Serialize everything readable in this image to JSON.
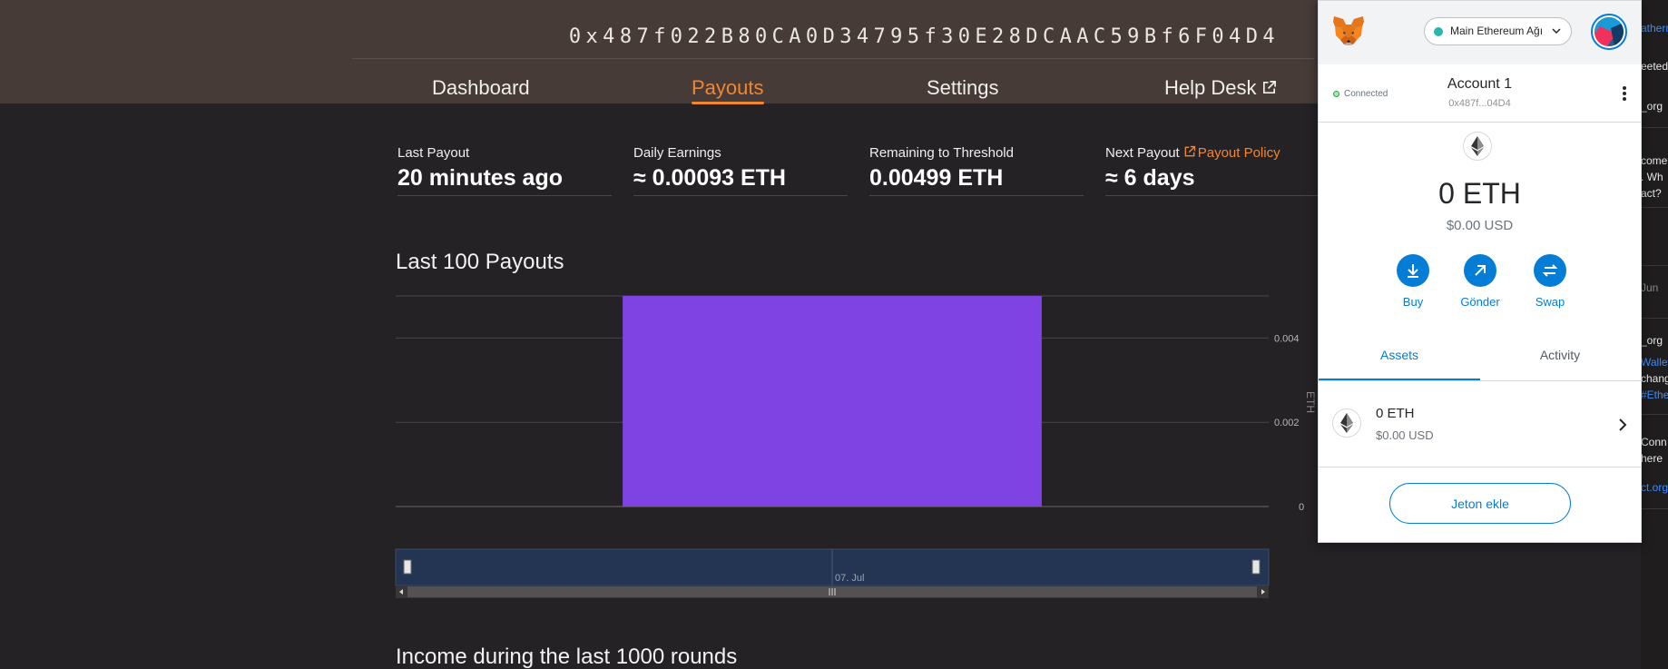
{
  "header": {
    "address": "0x487f022B80CA0D34795f30E28DCAAC59Bf6F04D4",
    "nav": {
      "dashboard": "Dashboard",
      "payouts": "Payouts",
      "settings": "Settings",
      "help_desk": "Help Desk"
    },
    "active_tab": "payouts",
    "accent_color": "#f1862f"
  },
  "stats": [
    {
      "label": "Last Payout",
      "value": "20 minutes ago"
    },
    {
      "label": "Daily Earnings",
      "value": "≈ 0.00093  ETH"
    },
    {
      "label": "Remaining to Threshold",
      "value": "0.00499  ETH"
    },
    {
      "label": "Next Payout",
      "value": "≈ 6 days",
      "link": "Payout Policy"
    }
  ],
  "sections": {
    "payouts_title": "Last 100 Payouts",
    "income_title": "Income during the last 1000 rounds"
  },
  "chart_data": {
    "type": "bar",
    "categories": [
      "07. Jul"
    ],
    "values": [
      0.005
    ],
    "title": "Last 100 Payouts",
    "xlabel": "",
    "ylabel": "ETH",
    "ylim": [
      0,
      0.005
    ],
    "yticks": [
      0,
      0.002,
      0.004
    ],
    "ytick_labels": [
      "0",
      "0.002",
      "0.004"
    ],
    "y_axis_side": "right",
    "grid": true,
    "bar_color": "#8043e3",
    "navigator_label": "07. Jul"
  },
  "metamask": {
    "network": "Main Ethereum Ağı",
    "network_color": "#29b6af",
    "connected_label": "Connected",
    "account_name": "Account 1",
    "account_address": "0x487f...04D4",
    "balance": "0 ETH",
    "balance_usd": "$0.00 USD",
    "actions": {
      "buy": "Buy",
      "send": "Gönder",
      "swap": "Swap"
    },
    "tabs": {
      "assets": "Assets",
      "activity": "Activity"
    },
    "active_tab": "assets",
    "asset": {
      "balance": "0 ETH",
      "usd": "$0.00 USD"
    },
    "add_token": "Jeton ekle",
    "brand_color": "#037dd6"
  },
  "side_strip": {
    "items": [
      {
        "text": "atherm",
        "style": "link"
      },
      {
        "text": "eeted",
        "style": "text"
      },
      {
        "text": "_org",
        "style": "text"
      },
      {
        "text": "come",
        "style": "text"
      },
      {
        "text": ". Wh",
        "style": "text"
      },
      {
        "text": "act?",
        "style": "text"
      },
      {
        "text": "Jun",
        "style": "dim"
      },
      {
        "text": "_org",
        "style": "text"
      },
      {
        "text": "Wallet",
        "style": "link"
      },
      {
        "text": "chang",
        "style": "text"
      },
      {
        "text": "#Ether",
        "style": "link"
      },
      {
        "text": "Conn",
        "style": "text"
      },
      {
        "text": "here",
        "style": "text"
      },
      {
        "text": "ct.org",
        "style": "link"
      }
    ]
  }
}
